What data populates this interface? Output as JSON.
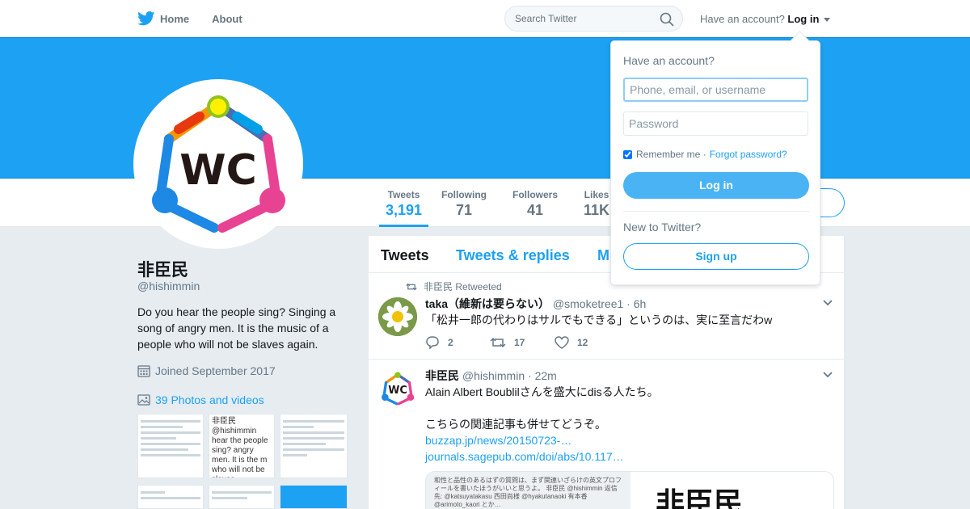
{
  "nav": {
    "home": "Home",
    "about": "About",
    "search_placeholder": "Search Twitter",
    "have_account": "Have an account?",
    "login": "Log in"
  },
  "profile": {
    "avatar_text": "WC",
    "name": "非臣民",
    "handle": "@hishimmin",
    "bio": "Do you hear the people sing? Singing a song of angry men. It is the music of a people who will not be slaves again.",
    "joined": "Joined September 2017",
    "photos": "39 Photos and videos",
    "thumbs": [
      "リプライ先: @hishimmin ツイートしてはいけない 見えても…",
      "非臣民 @hishimmin hear the people sing? angry men. It is the m who will not be slaves",
      "ラッセルが会いたい いいこう 知ってほしい…"
    ]
  },
  "stats": [
    {
      "label": "Tweets",
      "value": "3,191"
    },
    {
      "label": "Following",
      "value": "71"
    },
    {
      "label": "Followers",
      "value": "41"
    },
    {
      "label": "Likes",
      "value": "11K"
    }
  ],
  "timeline": {
    "tabs": [
      "Tweets",
      "Tweets & replies",
      "M"
    ],
    "tweets": [
      {
        "retweeted_by": "非臣民 Retweeted",
        "name": "taka（維新は要らない）",
        "handle": "@smoketree1",
        "time": "· 6h",
        "text": "「松井一郎の代わりはサルでもできる」というのは、実に至言だわw",
        "replies": "2",
        "retweets": "17",
        "likes": "12"
      },
      {
        "name": "非臣民",
        "handle": "@hishimmin",
        "time": "· 22m",
        "text1": "Alain Albert Boublilさんを盛大にdisる人たち。",
        "text2": "こちらの関連記事も併せてどうぞ。",
        "link1": "buzzap.jp/news/20150723-…",
        "link2": "journals.sagepub.com/doi/abs/10.117…",
        "media_left": "和性と品性のあるはずの質問は、まず関連いざらけの英文プロフィールを書いたほうがいいと思うよ。 非臣民 @hishimmin 返信先: @katsuyatakasu 西田尚様 @hyakutanaoki 有本香 @arimoto_kaori とか…",
        "media_right": "非臣民"
      }
    ]
  },
  "login": {
    "heading": "Have an account?",
    "user_placeholder": "Phone, email, or username",
    "password_placeholder": "Password",
    "remember": "Remember me ·",
    "forgot": "Forgot password?",
    "login_button": "Log in",
    "new_to": "New to Twitter?",
    "signup": "Sign up"
  },
  "colors": {
    "brand": "#1da1f2",
    "banner": "#1da1f2",
    "background": "#e6ecf0"
  }
}
